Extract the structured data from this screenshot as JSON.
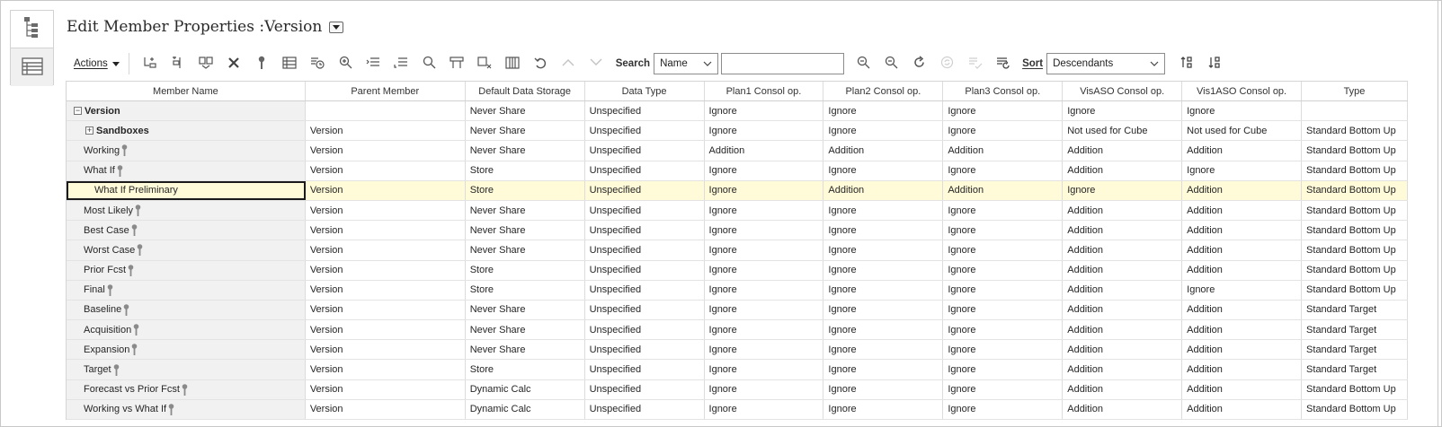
{
  "page": {
    "title": "Edit Member Properties :Version"
  },
  "toolbar": {
    "actions_label": "Actions",
    "search_label": "Search",
    "search_field": "Name",
    "search_value": "",
    "sort_label": "Sort",
    "sort_value": "Descendants"
  },
  "columns": [
    "Member Name",
    "Parent Member",
    "Default Data Storage",
    "Data Type",
    "Plan1 Consol op.",
    "Plan2 Consol op.",
    "Plan3 Consol op.",
    "VisASO Consol op.",
    "Vis1ASO Consol op.",
    "Type"
  ],
  "rows": [
    {
      "name": "Version",
      "parent": "",
      "storage": "Never Share",
      "dtype": "Unspecified",
      "p1": "Ignore",
      "p2": "Ignore",
      "p3": "Ignore",
      "vaso": "Ignore",
      "v1aso": "Ignore",
      "type": ""
    },
    {
      "name": "Sandboxes",
      "parent": "Version",
      "storage": "Never Share",
      "dtype": "Unspecified",
      "p1": "Ignore",
      "p2": "Ignore",
      "p3": "Ignore",
      "vaso": "Not used for Cube",
      "v1aso": "Not used for Cube",
      "type": "Standard Bottom Up"
    },
    {
      "name": "Working",
      "parent": "Version",
      "storage": "Never Share",
      "dtype": "Unspecified",
      "p1": "Addition",
      "p2": "Addition",
      "p3": "Addition",
      "vaso": "Addition",
      "v1aso": "Addition",
      "type": "Standard Bottom Up"
    },
    {
      "name": "What If",
      "parent": "Version",
      "storage": "Store",
      "dtype": "Unspecified",
      "p1": "Ignore",
      "p2": "Ignore",
      "p3": "Ignore",
      "vaso": "Addition",
      "v1aso": "Ignore",
      "type": "Standard Bottom Up"
    },
    {
      "name": "What If Preliminary",
      "parent": "Version",
      "storage": "Store",
      "dtype": "Unspecified",
      "p1": "Ignore",
      "p2": "Addition",
      "p3": "Addition",
      "vaso": "Ignore",
      "v1aso": "Addition",
      "type": "Standard Bottom Up"
    },
    {
      "name": "Most Likely",
      "parent": "Version",
      "storage": "Never Share",
      "dtype": "Unspecified",
      "p1": "Ignore",
      "p2": "Ignore",
      "p3": "Ignore",
      "vaso": "Addition",
      "v1aso": "Addition",
      "type": "Standard Bottom Up"
    },
    {
      "name": "Best Case",
      "parent": "Version",
      "storage": "Never Share",
      "dtype": "Unspecified",
      "p1": "Ignore",
      "p2": "Ignore",
      "p3": "Ignore",
      "vaso": "Addition",
      "v1aso": "Addition",
      "type": "Standard Bottom Up"
    },
    {
      "name": "Worst Case",
      "parent": "Version",
      "storage": "Never Share",
      "dtype": "Unspecified",
      "p1": "Ignore",
      "p2": "Ignore",
      "p3": "Ignore",
      "vaso": "Addition",
      "v1aso": "Addition",
      "type": "Standard Bottom Up"
    },
    {
      "name": "Prior Fcst",
      "parent": "Version",
      "storage": "Store",
      "dtype": "Unspecified",
      "p1": "Ignore",
      "p2": "Ignore",
      "p3": "Ignore",
      "vaso": "Addition",
      "v1aso": "Addition",
      "type": "Standard Bottom Up"
    },
    {
      "name": "Final",
      "parent": "Version",
      "storage": "Store",
      "dtype": "Unspecified",
      "p1": "Ignore",
      "p2": "Ignore",
      "p3": "Ignore",
      "vaso": "Addition",
      "v1aso": "Ignore",
      "type": "Standard Bottom Up"
    },
    {
      "name": "Baseline",
      "parent": "Version",
      "storage": "Never Share",
      "dtype": "Unspecified",
      "p1": "Ignore",
      "p2": "Ignore",
      "p3": "Ignore",
      "vaso": "Addition",
      "v1aso": "Addition",
      "type": "Standard Target"
    },
    {
      "name": "Acquisition",
      "parent": "Version",
      "storage": "Never Share",
      "dtype": "Unspecified",
      "p1": "Ignore",
      "p2": "Ignore",
      "p3": "Ignore",
      "vaso": "Addition",
      "v1aso": "Addition",
      "type": "Standard Target"
    },
    {
      "name": "Expansion",
      "parent": "Version",
      "storage": "Never Share",
      "dtype": "Unspecified",
      "p1": "Ignore",
      "p2": "Ignore",
      "p3": "Ignore",
      "vaso": "Addition",
      "v1aso": "Addition",
      "type": "Standard Target"
    },
    {
      "name": "Target",
      "parent": "Version",
      "storage": "Store",
      "dtype": "Unspecified",
      "p1": "Ignore",
      "p2": "Ignore",
      "p3": "Ignore",
      "vaso": "Addition",
      "v1aso": "Addition",
      "type": "Standard Target"
    },
    {
      "name": "Forecast vs Prior Fcst",
      "parent": "Version",
      "storage": "Dynamic Calc",
      "dtype": "Unspecified",
      "p1": "Ignore",
      "p2": "Ignore",
      "p3": "Ignore",
      "vaso": "Addition",
      "v1aso": "Addition",
      "type": "Standard Bottom Up"
    },
    {
      "name": "Working vs What If",
      "parent": "Version",
      "storage": "Dynamic Calc",
      "dtype": "Unspecified",
      "p1": "Ignore",
      "p2": "Ignore",
      "p3": "Ignore",
      "vaso": "Addition",
      "v1aso": "Addition",
      "type": "Standard Bottom Up"
    }
  ]
}
